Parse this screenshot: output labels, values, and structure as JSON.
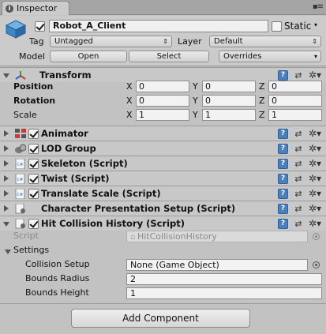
{
  "tab": {
    "label": "Inspector"
  },
  "object": {
    "active": true,
    "name": "Robot_A_Client",
    "static_label": "Static",
    "static": false,
    "tag_label": "Tag",
    "tag_value": "Untagged",
    "layer_label": "Layer",
    "layer_value": "Default",
    "model_label": "Model",
    "open_label": "Open",
    "select_label": "Select",
    "overrides_label": "Overrides"
  },
  "transform": {
    "title": "Transform",
    "position_label": "Position",
    "rotation_label": "Rotation",
    "scale_label": "Scale",
    "x_label": "X",
    "y_label": "Y",
    "z_label": "Z",
    "position": {
      "x": "0",
      "y": "0",
      "z": "0"
    },
    "rotation": {
      "x": "0",
      "y": "0",
      "z": "0"
    },
    "scale": {
      "x": "1",
      "y": "1",
      "z": "1"
    }
  },
  "components": [
    {
      "title": "Animator",
      "enabled": true
    },
    {
      "title": "LOD Group",
      "enabled": true
    },
    {
      "title": "Skeleton (Script)",
      "enabled": true
    },
    {
      "title": "Twist (Script)",
      "enabled": true
    },
    {
      "title": "Translate Scale (Script)",
      "enabled": true
    },
    {
      "title": "Character Presentation Setup (Script)"
    },
    {
      "title": "Hit Collision History (Script)",
      "enabled": true
    }
  ],
  "hit_collision": {
    "script_label": "Script",
    "script_value": "HitCollisionHistory",
    "settings_label": "Settings",
    "collision_setup_label": "Collision Setup",
    "collision_setup_value": "None (Game Object)",
    "bounds_radius_label": "Bounds Radius",
    "bounds_radius_value": "2",
    "bounds_height_label": "Bounds Height",
    "bounds_height_value": "1"
  },
  "add_component_label": "Add Component",
  "colors": {
    "help_blue": "#4d7fb8",
    "panel": "#c2c2c2",
    "header": "#cbcbcb"
  }
}
